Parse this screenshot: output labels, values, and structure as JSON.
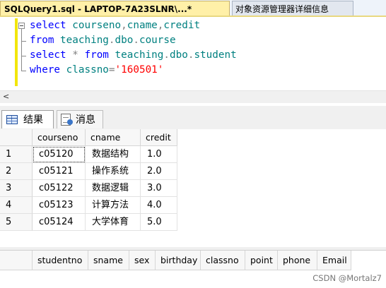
{
  "document_tabs": {
    "active": "SQLQuery1.sql - LAPTOP-7A23SLNR\\...*",
    "inactive": "对象资源管理器详细信息"
  },
  "editor": {
    "lines": [
      [
        {
          "t": "select ",
          "c": "kw"
        },
        {
          "t": "courseno",
          "c": "id"
        },
        {
          "t": ",",
          "c": "gray"
        },
        {
          "t": "cname",
          "c": "id"
        },
        {
          "t": ",",
          "c": "gray"
        },
        {
          "t": "credit",
          "c": "id"
        }
      ],
      [
        {
          "t": "from ",
          "c": "kw"
        },
        {
          "t": "teaching",
          "c": "id"
        },
        {
          "t": ".",
          "c": "gray"
        },
        {
          "t": "dbo",
          "c": "id"
        },
        {
          "t": ".",
          "c": "gray"
        },
        {
          "t": "course",
          "c": "id"
        }
      ],
      [
        {
          "t": "select ",
          "c": "kw"
        },
        {
          "t": "* ",
          "c": "gray"
        },
        {
          "t": "from ",
          "c": "kw"
        },
        {
          "t": "teaching",
          "c": "id"
        },
        {
          "t": ".",
          "c": "gray"
        },
        {
          "t": "dbo",
          "c": "id"
        },
        {
          "t": ".",
          "c": "gray"
        },
        {
          "t": "student",
          "c": "id"
        }
      ],
      [
        {
          "t": "where ",
          "c": "kw"
        },
        {
          "t": "classno",
          "c": "id"
        },
        {
          "t": "=",
          "c": "gray"
        },
        {
          "t": "'160501'",
          "c": "str"
        }
      ]
    ]
  },
  "scrollbar": {
    "left_arrow": "<"
  },
  "result_tabs": {
    "results": "结果",
    "messages": "消息"
  },
  "grid1": {
    "columns": [
      "courseno",
      "cname",
      "credit"
    ],
    "rows": [
      {
        "n": "1",
        "cells": [
          "c05120",
          "数据结构",
          "1.0"
        ]
      },
      {
        "n": "2",
        "cells": [
          "c05121",
          "操作系统",
          "2.0"
        ]
      },
      {
        "n": "3",
        "cells": [
          "c05122",
          "数据逻辑",
          "3.0"
        ]
      },
      {
        "n": "4",
        "cells": [
          "c05123",
          "计算方法",
          "4.0"
        ]
      },
      {
        "n": "5",
        "cells": [
          "c05124",
          "大学体育",
          "5.0"
        ]
      }
    ]
  },
  "grid2": {
    "columns": [
      "studentno",
      "sname",
      "sex",
      "birthday",
      "classno",
      "point",
      "phone",
      "Email"
    ]
  },
  "watermark": "CSDN @Mortalz7"
}
